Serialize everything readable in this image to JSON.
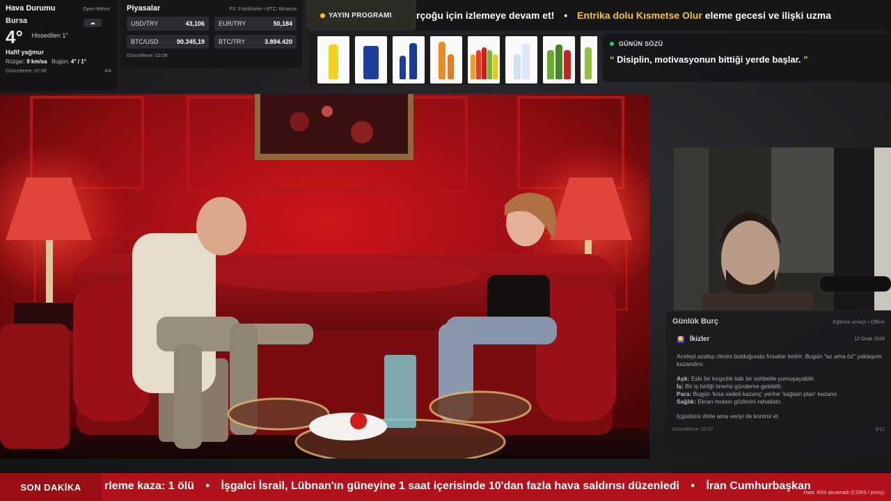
{
  "weather": {
    "title": "Hava Durumu",
    "source": "Open-Meteo",
    "city": "Bursa",
    "icon": "cloud-rain-icon",
    "temp": "4°",
    "feels_like": "Hissedilen 1°",
    "description": "Hafif yağmur",
    "wind_label": "Rüzgar:",
    "wind_value": "9 km/sa",
    "today_label": "Bugün:",
    "today_value": "4° / 1°",
    "updated": "Güncelleme: 02:06",
    "page": "4/4"
  },
  "markets": {
    "title": "Piyasalar",
    "source": "FX: Frankfurter • BTC: Binance",
    "rates": [
      {
        "pair": "USD/TRY",
        "value": "43,106"
      },
      {
        "pair": "EUR/TRY",
        "value": "50,184"
      },
      {
        "pair": "BTC/USD",
        "value": "90.345,19"
      },
      {
        "pair": "BTC/TRY",
        "value": "3.894.420"
      }
    ],
    "updated": "Güncelleme: 02:06"
  },
  "top_ticker": {
    "label": "YAYIN PROGRAMI",
    "items": [
      {
        "text": "rçoğu için izlemeye devam et!"
      },
      {
        "highlight": "Entrika dolu Kısmetse Olur",
        "text": " eleme gecesi ve ilişki uzma"
      }
    ]
  },
  "quote": {
    "label": "GÜNÜN SÖZÜ",
    "open_mark": "“",
    "text": "Disiplin, motivasyonun bittiği yerde başlar.",
    "close_mark": "”"
  },
  "horoscope": {
    "title": "Günlük Burç",
    "source": "Eğlence amaçlı • Offline",
    "sign_symbol": "♊",
    "sign": "İkizler",
    "date": "12 Ocak 2026",
    "intro": "Aceleyi azaltıp ritmini bulduğunda fırsatlar belirir. Bugün \"az ama öz\" yaklaşımı kazandırır.",
    "love_label": "Aşk:",
    "love": "Eski bir kırgınlık tatlı bir sohbetle yumuşayabilir.",
    "work_label": "İş:",
    "work": "Bir iş birliği önerisi gündeme gelebilir.",
    "money_label": "Para:",
    "money": "Bugün 'kısa vadeli kazanç' yerine 'sağlam plan' kazanır.",
    "health_label": "Sağlık:",
    "health": "Ekran molası gözlerini rahatlatır.",
    "advice": "İçgüdünü dinle ama veriyi de kontrol et.",
    "updated": "Güncelleme: 02:07",
    "page": "3/12"
  },
  "breaking": {
    "label": "SON DAKİKA",
    "items": [
      "rleme kaza: 1 ölü",
      "İşgalci İsrail, Lübnan'ın güneyine 1 saat içerisinde 10'dan fazla hava saldırısı düzenledi",
      "İran Cumhurbaşkan"
    ],
    "separator": "•",
    "error": "Hata: RSS alınamadı (CORS / proxy)."
  },
  "colors": {
    "accent_yellow": "#f5c518",
    "breaking_red": "#b3121a",
    "live_green": "#3cc65a"
  }
}
